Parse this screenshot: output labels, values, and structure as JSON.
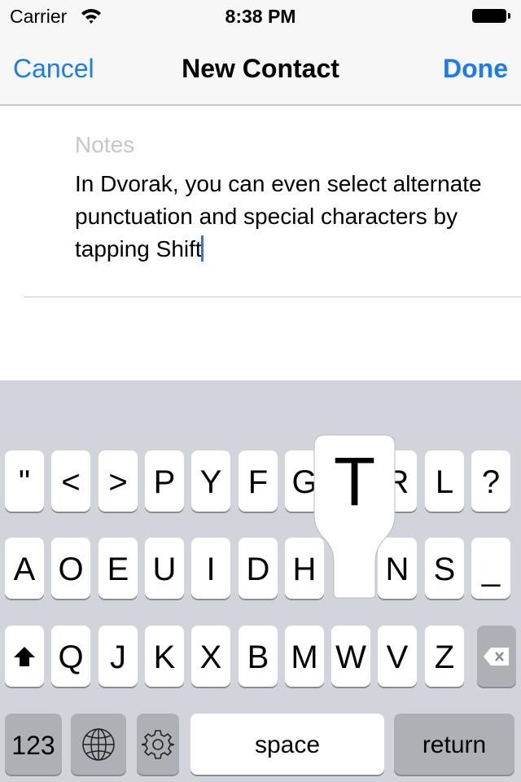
{
  "status_bar": {
    "carrier": "Carrier",
    "time": "8:38 PM",
    "wifi_icon": "wifi-icon",
    "battery_icon": "battery-icon"
  },
  "navbar": {
    "cancel": "Cancel",
    "title": "New Contact",
    "done": "Done"
  },
  "notes": {
    "label": "Notes",
    "value": "In Dvorak, you can even select alternate punctuation and special characters by tapping Shift"
  },
  "keyboard": {
    "layout": "Dvorak",
    "row1": [
      "\"",
      "<",
      ">",
      "P",
      "Y",
      "F",
      "G",
      "T",
      "R",
      "L",
      "?"
    ],
    "row2": [
      "A",
      "O",
      "E",
      "U",
      "I",
      "D",
      "H",
      "T",
      "N",
      "S",
      "_"
    ],
    "row3": [
      "Q",
      "J",
      "K",
      "X",
      "B",
      "M",
      "W",
      "V",
      "Z"
    ],
    "shift_icon": "shift-arrow-icon",
    "delete_icon": "backspace-icon",
    "numbers_label": "123",
    "globe_icon": "globe-icon",
    "settings_icon": "gear-icon",
    "space_label": "space",
    "return_label": "return",
    "popup_letter": "T"
  },
  "colors": {
    "accent": "#1a7cf0",
    "keyboard_bg": "#d1d5db",
    "dark_key": "#adb0b5",
    "cursor": "#3b6fdc"
  }
}
